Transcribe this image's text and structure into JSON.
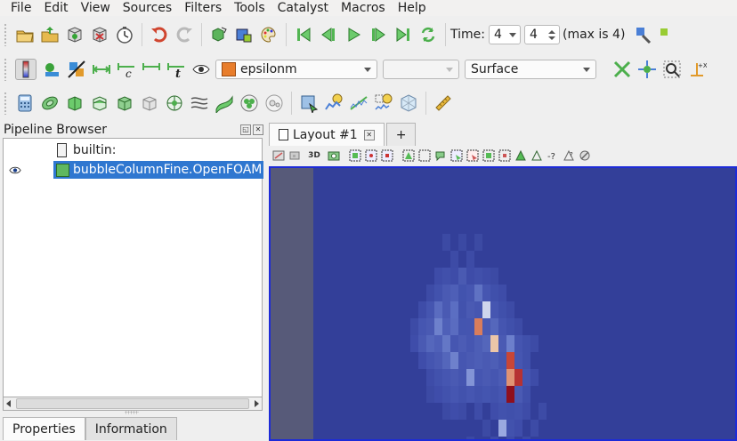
{
  "menu": [
    "File",
    "Edit",
    "View",
    "Sources",
    "Filters",
    "Tools",
    "Catalyst",
    "Macros",
    "Help"
  ],
  "toolbar": {
    "time_label": "Time:",
    "time_value": "4",
    "time_step": "4",
    "time_max": "(max is 4)",
    "array_name": "epsilonm",
    "component": "",
    "representation": "Surface",
    "t_label": "t",
    "c_label": "c"
  },
  "pipeline": {
    "title": "Pipeline Browser",
    "items": [
      {
        "label": "builtin:"
      },
      {
        "label": "bubbleColumnFine.OpenFOAM"
      }
    ]
  },
  "bottom_tabs": [
    "Properties",
    "Information"
  ],
  "layout": {
    "tab_label": "Layout #1",
    "add_label": "+",
    "view_toolbar_3d": "3D"
  },
  "colors": {
    "accent": "#1d2bd8",
    "selection": "#2f77d0",
    "background_blue": "#333f99"
  }
}
